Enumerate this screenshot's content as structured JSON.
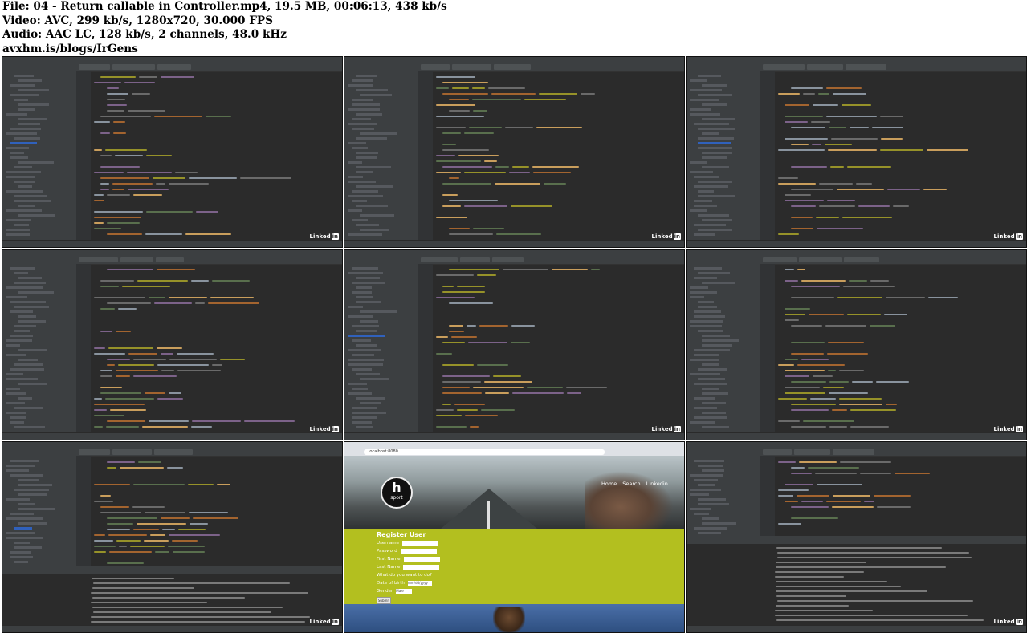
{
  "header": {
    "line1": "File: 04 - Return callable in Controller.mp4, 19.5 MB, 00:06:13, 438 kb/s",
    "line2": "Video: AVC, 299 kb/s, 1280x720, 30.000 FPS",
    "line3": "Audio: AAC LC, 128 kb/s, 2 channels, 48.0 kHz",
    "line4": "avxhm.is/blogs/IrGens"
  },
  "thumbnails": [
    {
      "type": "ide",
      "watermark": "Linked",
      "watermark_in": "in"
    },
    {
      "type": "ide",
      "watermark": "Linked",
      "watermark_in": "in"
    },
    {
      "type": "ide",
      "watermark": "Linked",
      "watermark_in": "in"
    },
    {
      "type": "ide",
      "watermark": "Linked",
      "watermark_in": "in"
    },
    {
      "type": "ide",
      "watermark": "Linked",
      "watermark_in": "in"
    },
    {
      "type": "ide",
      "watermark": "Linked",
      "watermark_in": "in"
    },
    {
      "type": "ide-console",
      "watermark": "Linked",
      "watermark_in": "in"
    },
    {
      "type": "web",
      "url": "localhost:8080",
      "logo_letter": "h",
      "logo_word": "sport",
      "nav": [
        "Home",
        "Search",
        "Linkedin"
      ],
      "form_title": "Register User",
      "fields": [
        "Username",
        "Password",
        "First Name",
        "Last Name",
        "What do you want to do?",
        "Date of birth",
        "Gender"
      ],
      "date_value": "mm/dd/yyyy",
      "gender_value": "Male",
      "submit_label": "Submit"
    },
    {
      "type": "ide-console",
      "watermark": "Linked",
      "watermark_in": "in"
    }
  ]
}
